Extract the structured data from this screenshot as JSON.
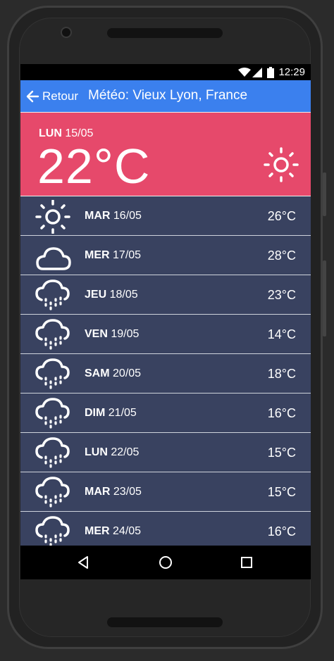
{
  "status_bar": {
    "time": "12:29"
  },
  "app_bar": {
    "back_label": "Retour",
    "title": "Météo: Vieux Lyon, France"
  },
  "today": {
    "day": "LUN",
    "date": "15/05",
    "temperature": "22°C",
    "icon": "sun-icon"
  },
  "forecast": [
    {
      "day": "MAR",
      "date": "16/05",
      "temperature": "26°C",
      "icon": "sun-icon"
    },
    {
      "day": "MER",
      "date": "17/05",
      "temperature": "28°C",
      "icon": "cloud-icon"
    },
    {
      "day": "JEU",
      "date": "18/05",
      "temperature": "23°C",
      "icon": "rain-icon"
    },
    {
      "day": "VEN",
      "date": "19/05",
      "temperature": "14°C",
      "icon": "rain-icon"
    },
    {
      "day": "SAM",
      "date": "20/05",
      "temperature": "18°C",
      "icon": "rain-icon"
    },
    {
      "day": "DIM",
      "date": "21/05",
      "temperature": "16°C",
      "icon": "rain-icon"
    },
    {
      "day": "LUN",
      "date": "22/05",
      "temperature": "15°C",
      "icon": "rain-icon"
    },
    {
      "day": "MAR",
      "date": "23/05",
      "temperature": "15°C",
      "icon": "rain-icon"
    },
    {
      "day": "MER",
      "date": "24/05",
      "temperature": "16°C",
      "icon": "rain-icon"
    }
  ],
  "colors": {
    "app_bar": "#3b80ee",
    "today_bg": "#e6496b",
    "row_bg": "#394260"
  }
}
